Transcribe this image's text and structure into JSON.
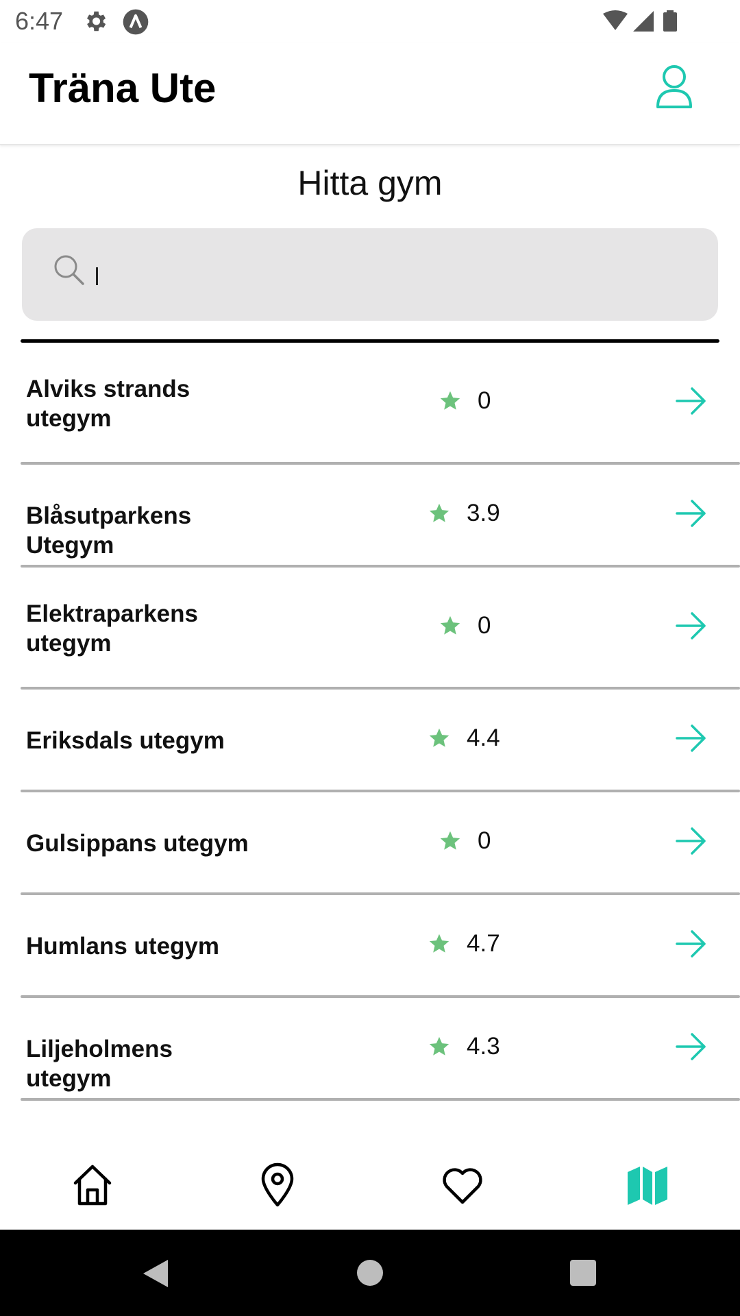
{
  "status_bar": {
    "time": "6:47"
  },
  "app_bar": {
    "title": "Träna Ute"
  },
  "page": {
    "title": "Hitta gym"
  },
  "search": {
    "value": "",
    "placeholder": ""
  },
  "gyms": [
    {
      "name": "Alviks strands utegym",
      "rating": "0"
    },
    {
      "name": "Blåsutparkens Utegym",
      "rating": "3.9"
    },
    {
      "name": "Elektraparkens utegym",
      "rating": "0"
    },
    {
      "name": "Eriksdals utegym",
      "rating": "4.4"
    },
    {
      "name": "Gulsippans utegym",
      "rating": "0"
    },
    {
      "name": "Humlans utegym",
      "rating": "4.7"
    },
    {
      "name": "Liljeholmens utegym",
      "rating": "4.3"
    }
  ],
  "bottom_nav": {
    "items": [
      {
        "icon": "home-icon",
        "active": false
      },
      {
        "icon": "location-pin-icon",
        "active": false
      },
      {
        "icon": "heart-icon",
        "active": false
      },
      {
        "icon": "map-icon",
        "active": true
      }
    ]
  },
  "colors": {
    "accent": "#1ec8b0",
    "star": "#6cc27c",
    "search_bg": "#e6e5e6",
    "divider": "#b0b0b0"
  }
}
